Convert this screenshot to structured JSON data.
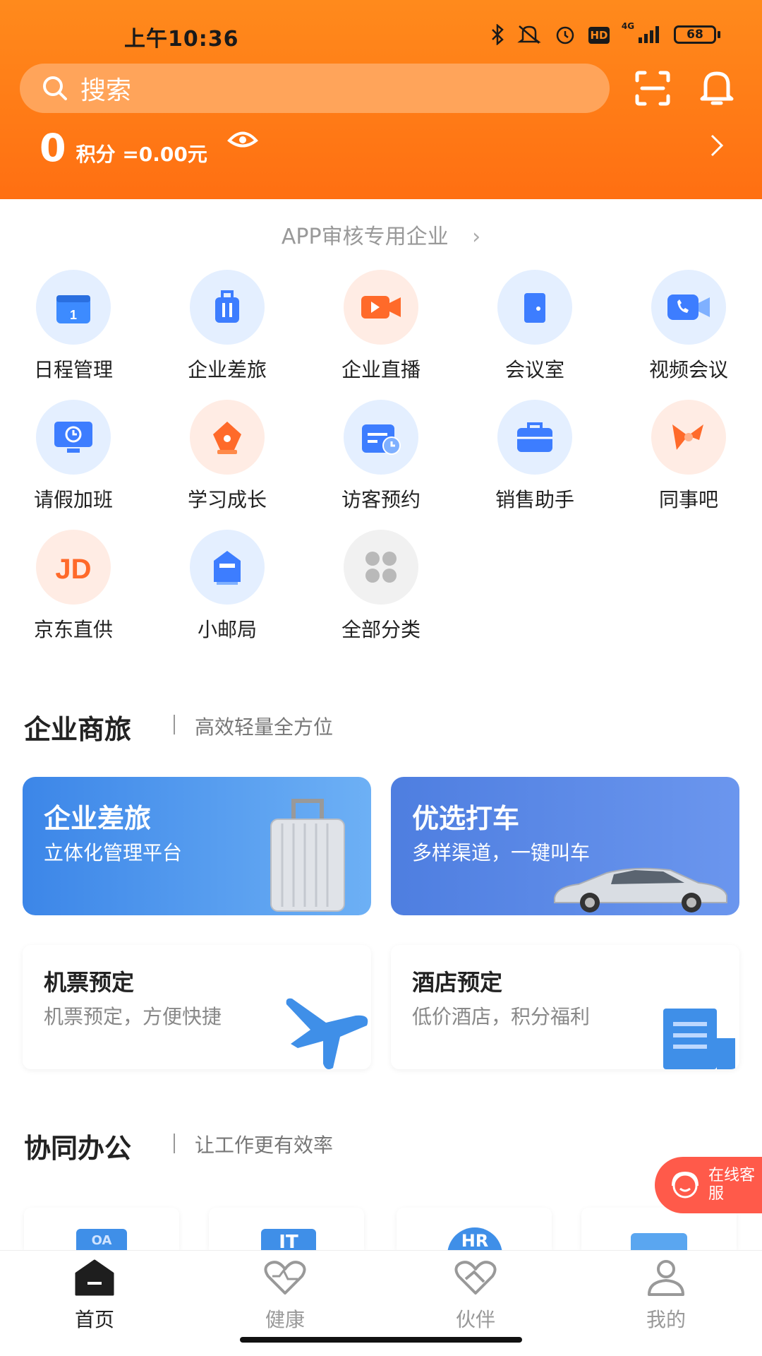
{
  "status_bar": {
    "time": "上午10:36",
    "battery": "68",
    "hd": "HD",
    "network": "4G"
  },
  "search": {
    "placeholder": "搜索"
  },
  "points": {
    "value": "0",
    "label": "积分 =0.00元"
  },
  "company": {
    "name": "APP审核专用企业"
  },
  "apps": [
    {
      "label": "日程管理",
      "icon": "calendar-icon",
      "color": "#3d8bff"
    },
    {
      "label": "企业差旅",
      "icon": "luggage-icon",
      "color": "#3d7dff"
    },
    {
      "label": "企业直播",
      "icon": "video-camera-icon",
      "color": "#ff6a2a"
    },
    {
      "label": "会议室",
      "icon": "door-icon",
      "color": "#3d7dff"
    },
    {
      "label": "视频会议",
      "icon": "video-call-icon",
      "color": "#3d7dff"
    },
    {
      "label": "请假加班",
      "icon": "monitor-clock-icon",
      "color": "#3d7dff"
    },
    {
      "label": "学习成长",
      "icon": "pen-nib-icon",
      "color": "#ff6a2a"
    },
    {
      "label": "访客预约",
      "icon": "calendar-clock-icon",
      "color": "#3d7dff"
    },
    {
      "label": "销售助手",
      "icon": "briefcase-icon",
      "color": "#3d7dff"
    },
    {
      "label": "同事吧",
      "icon": "bow-icon",
      "color": "#ff6a2a"
    },
    {
      "label": "京东直供",
      "icon": "jd-logo-icon",
      "color": "#ff6a2a"
    },
    {
      "label": "小邮局",
      "icon": "mailbox-icon",
      "color": "#3d7dff"
    },
    {
      "label": "全部分类",
      "icon": "grid-icon",
      "color": "#b9b9b9"
    }
  ],
  "section_travel": {
    "title": "企业商旅",
    "subtitle": "高效轻量全方位"
  },
  "travel_cards": [
    {
      "title": "企业差旅",
      "subtitle": "立体化管理平台"
    },
    {
      "title": "优选打车",
      "subtitle": "多样渠道，一键叫车"
    }
  ],
  "booking_cards": [
    {
      "title": "机票预定",
      "subtitle": "机票预定，方便快捷"
    },
    {
      "title": "酒店预定",
      "subtitle": "低价酒店，积分福利"
    }
  ],
  "section_office": {
    "title": "协同办公",
    "subtitle": "让工作更有效率"
  },
  "office_icons": [
    "OA",
    "IT",
    "HR",
    ""
  ],
  "kefu": {
    "label": "在线客服"
  },
  "nav": [
    {
      "label": "首页",
      "icon": "home-icon",
      "active": true
    },
    {
      "label": "健康",
      "icon": "heart-icon",
      "active": false
    },
    {
      "label": "伙伴",
      "icon": "partner-icon",
      "active": false
    },
    {
      "label": "我的",
      "icon": "user-icon",
      "active": false
    }
  ],
  "colors": {
    "header": "#ff7a16",
    "accent_blue": "#3d7dff",
    "accent_orange": "#ff6a2a"
  }
}
